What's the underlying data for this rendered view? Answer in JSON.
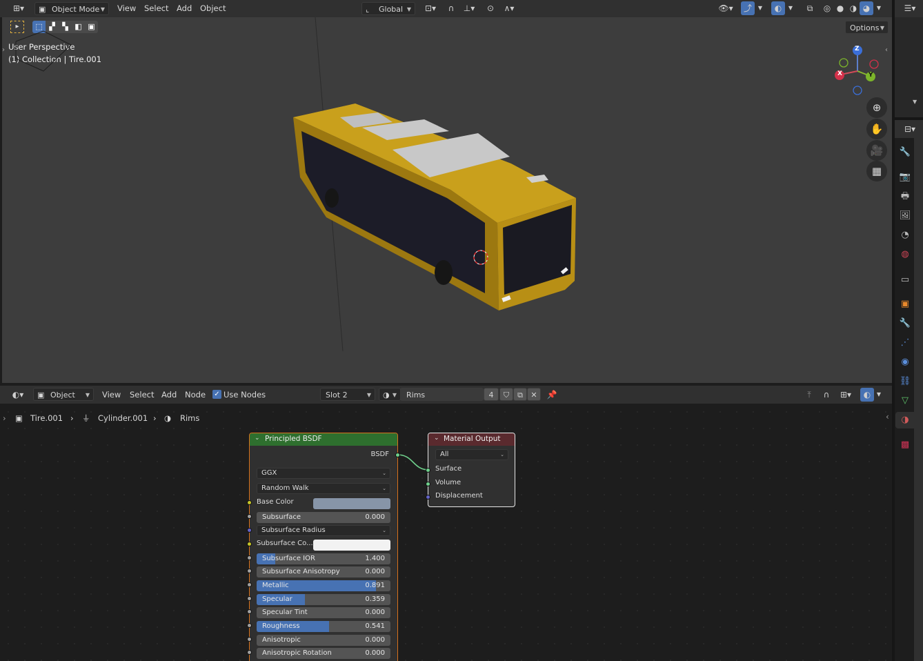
{
  "top_header": {
    "editor_type_icon": "editor-type-icon",
    "mode_label": "Object Mode",
    "menus": [
      "View",
      "Select",
      "Add",
      "Object"
    ],
    "transform_orientation": "Global",
    "options_label": "Options"
  },
  "viewport": {
    "overlay_title": "User Perspective",
    "overlay_subtitle": "(1) Collection | Tire.001",
    "axes": {
      "z": "Z",
      "y": "Y",
      "x": "X"
    },
    "background": "#3d3d3d"
  },
  "node_header": {
    "mode_label": "Object",
    "menus": [
      "View",
      "Select",
      "Add",
      "Node"
    ],
    "use_nodes_label": "Use Nodes",
    "use_nodes_checked": true,
    "slot_label": "Slot 2",
    "material_name": "Rims",
    "user_count": "4"
  },
  "breadcrumb": {
    "object": "Tire.001",
    "mesh": "Cylinder.001",
    "material": "Rims"
  },
  "principled_node": {
    "title": "Principled BSDF",
    "output_label": "BSDF",
    "distribution": "GGX",
    "subsurface_method": "Random Walk",
    "base_color_label": "Base Color",
    "base_color": "#8795a8",
    "subsurface_color_label": "Subsurface Co...",
    "subsurface_color": "#f2f2f2",
    "subsurface_radius_label": "Subsurface Radius",
    "fields": [
      {
        "label": "Subsurface",
        "value": "0.000",
        "fraction": 0
      },
      {
        "label": "Subsurface IOR",
        "value": "1.400",
        "fraction": 0.14
      },
      {
        "label": "Subsurface Anisotropy",
        "value": "0.000",
        "fraction": 0
      },
      {
        "label": "Metallic",
        "value": "0.891",
        "fraction": 0.891
      },
      {
        "label": "Specular",
        "value": "0.359",
        "fraction": 0.359
      },
      {
        "label": "Specular Tint",
        "value": "0.000",
        "fraction": 0
      },
      {
        "label": "Roughness",
        "value": "0.541",
        "fraction": 0.541
      },
      {
        "label": "Anisotropic",
        "value": "0.000",
        "fraction": 0
      },
      {
        "label": "Anisotropic Rotation",
        "value": "0.000",
        "fraction": 0
      }
    ]
  },
  "output_node": {
    "title": "Material Output",
    "target": "All",
    "inputs": [
      "Surface",
      "Volume",
      "Displacement"
    ]
  },
  "colors": {
    "accent": "#4772b3",
    "shader_header": "#2e6f2e",
    "output_header": "#5a2a2e",
    "bus_yellow": "#c9a01c"
  }
}
